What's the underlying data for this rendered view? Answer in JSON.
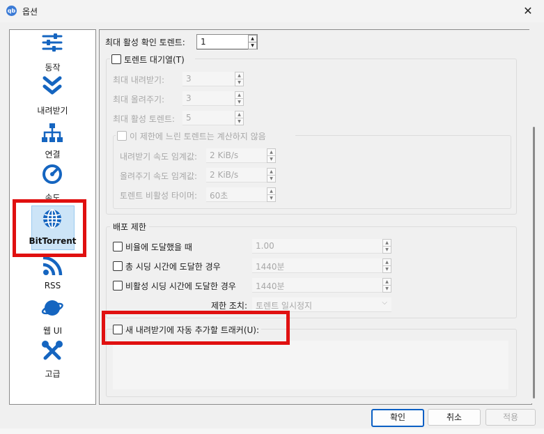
{
  "window": {
    "title": "옵션",
    "app_icon": "qb"
  },
  "sidebar": {
    "items": [
      {
        "label": "동작",
        "icon": "sliders-icon"
      },
      {
        "label": "내려받기",
        "icon": "download-chevrons-icon"
      },
      {
        "label": "연결",
        "icon": "network-icon"
      },
      {
        "label": "속도",
        "icon": "speedometer-icon"
      },
      {
        "label": "BitTorrent",
        "icon": "globe-icon",
        "selected": true
      },
      {
        "label": "RSS",
        "icon": "rss-icon"
      },
      {
        "label": "웹 UI",
        "icon": "planet-icon"
      },
      {
        "label": "고급",
        "icon": "tools-icon"
      }
    ]
  },
  "content": {
    "max_active_checking": {
      "label": "최대 활성 확인 토렌트:",
      "value": "1"
    },
    "queue": {
      "label": "토렌트 대기열(T)",
      "max_downloads": {
        "label": "최대 내려받기:",
        "value": "3"
      },
      "max_uploads": {
        "label": "최대 올려주기:",
        "value": "3"
      },
      "max_active": {
        "label": "최대 활성 토렌트:",
        "value": "5"
      },
      "slow_group": {
        "label": "이 제한에 느린 토렌트는 계산하지 않음",
        "dl_threshold": {
          "label": "내려받기 속도 임계값:",
          "value": "2 KiB/s"
        },
        "ul_threshold": {
          "label": "올려주기 속도 임계값:",
          "value": "2 KiB/s"
        },
        "inactivity": {
          "label": "토렌트 비활성 타이머:",
          "value": "60초"
        }
      }
    },
    "seeding": {
      "title": "배포 제한",
      "ratio": {
        "label": "비율에 도달했을 때",
        "value": "1.00"
      },
      "seed_time": {
        "label": "총 시딩 시간에 도달한 경우",
        "value": "1440분"
      },
      "inactive_seed_time": {
        "label": "비활성 시딩 시간에 도달한 경우",
        "value": "1440분"
      },
      "action": {
        "label": "제한 조치:",
        "value": "토렌트 일시정지"
      }
    },
    "trackers": {
      "label": "새 내려받기에 자동 추가할 트래커(U):"
    }
  },
  "buttons": {
    "ok": "확인",
    "cancel": "취소",
    "apply": "적용"
  },
  "colors": {
    "highlight_box": "#e01010",
    "selected_bg": "#cce4f7",
    "icon_blue": "#1565c0"
  }
}
